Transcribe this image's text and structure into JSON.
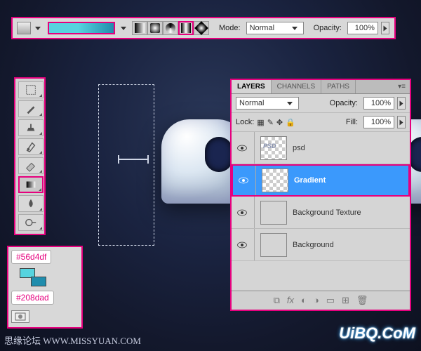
{
  "optionsBar": {
    "modeLabel": "Mode:",
    "modeValue": "Normal",
    "opacityLabel": "Opacity:",
    "opacityValue": "100%"
  },
  "gradientColors": {
    "start": "#56d4df",
    "end": "#208dad"
  },
  "colorCallout": {
    "label1": "#56d4df",
    "label2": "#208dad"
  },
  "layersPanel": {
    "tabs": {
      "layers": "LAYERS",
      "channels": "CHANNELS",
      "paths": "PATHS"
    },
    "blendModeLabel": "Normal",
    "opacityLabel": "Opacity:",
    "opacityValue": "100%",
    "lockLabel": "Lock:",
    "fillLabel": "Fill:",
    "fillValue": "100%",
    "layers": [
      {
        "name": "psd"
      },
      {
        "name": "Gradient"
      },
      {
        "name": "Background Texture"
      },
      {
        "name": "Background"
      }
    ]
  },
  "watermark": {
    "left": "思缘论坛 WWW.MISSYUAN.COM",
    "right": "UiBQ.CoM"
  }
}
